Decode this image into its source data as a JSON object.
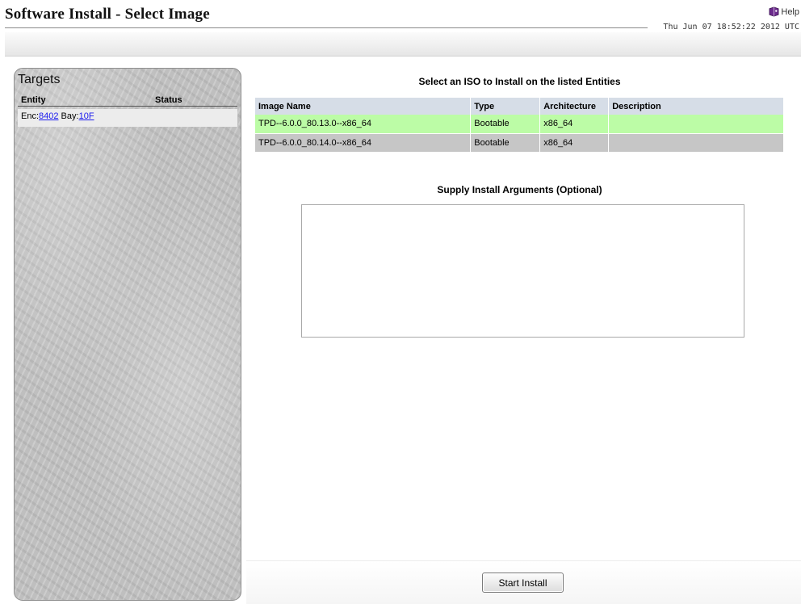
{
  "header": {
    "title": "Software Install - Select Image",
    "help_label": "Help",
    "timestamp": "Thu Jun 07 18:52:22 2012 UTC"
  },
  "targets": {
    "title": "Targets",
    "columns": {
      "entity": "Entity",
      "status": "Status"
    },
    "rows": [
      {
        "enc_label": "Enc:",
        "enc_value": "8402",
        "bay_label": " Bay:",
        "bay_value": "10F",
        "status": ""
      }
    ]
  },
  "main": {
    "heading": "Select an ISO to Install on the listed Entities",
    "table": {
      "columns": [
        "Image Name",
        "Type",
        "Architecture",
        "Description"
      ],
      "rows": [
        {
          "name": "TPD--6.0.0_80.13.0--x86_64",
          "type": "Bootable",
          "arch": "x86_64",
          "description": "",
          "selected": true
        },
        {
          "name": "TPD--6.0.0_80.14.0--x86_64",
          "type": "Bootable",
          "arch": "x86_64",
          "description": "",
          "selected": false
        }
      ]
    },
    "args_heading": "Supply Install Arguments (Optional)",
    "args_value": "",
    "start_button": "Start Install"
  },
  "colors": {
    "selected_row": "#bcfca6",
    "normal_row": "#c6c6c6",
    "header_row": "#d6dde7",
    "link": "#1a1aee",
    "panel": "#c3c3c3"
  },
  "icons": {
    "help": "help-book-icon"
  }
}
